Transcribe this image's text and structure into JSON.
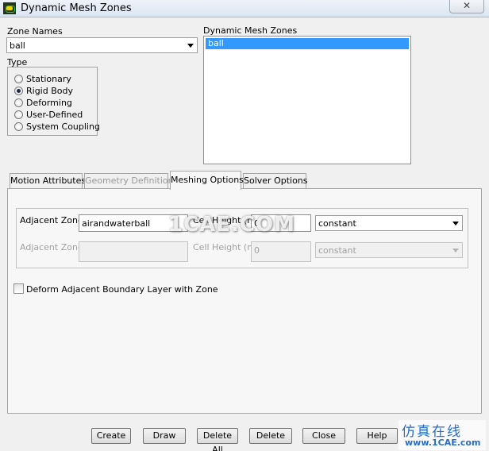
{
  "window": {
    "title": "Dynamic Mesh Zones",
    "close_glyph": "✕"
  },
  "zone_names": {
    "label": "Zone Names",
    "selected": "ball"
  },
  "type": {
    "label": "Type",
    "options": [
      {
        "label": "Stationary",
        "selected": false
      },
      {
        "label": "Rigid Body",
        "selected": true
      },
      {
        "label": "Deforming",
        "selected": false
      },
      {
        "label": "User-Defined",
        "selected": false
      },
      {
        "label": "System Coupling",
        "selected": false
      }
    ]
  },
  "dynamic_mesh_zones": {
    "label": "Dynamic Mesh Zones",
    "items": [
      "ball"
    ]
  },
  "tabs": [
    {
      "label": "Motion Attributes",
      "state": "normal"
    },
    {
      "label": "Geometry Definition",
      "state": "disabled"
    },
    {
      "label": "Meshing Options",
      "state": "active"
    },
    {
      "label": "Solver Options",
      "state": "normal"
    }
  ],
  "meshing": {
    "row1": {
      "zone_label": "Adjacent Zone",
      "zone_value": "airandwaterball",
      "height_label": "Cell Height (m)",
      "height_value": "0",
      "method": "constant"
    },
    "row2": {
      "zone_label": "Adjacent Zone",
      "zone_value": "",
      "height_label": "Cell Height (m)",
      "height_value": "0",
      "method": "constant"
    },
    "deform_checkbox": {
      "label": "Deform Adjacent Boundary Layer with Zone",
      "checked": false
    }
  },
  "buttons": [
    "Create",
    "Draw",
    "Delete All",
    "Delete",
    "Close",
    "Help"
  ],
  "watermark": {
    "main": "1CAE.COM",
    "site_cn": "仿真在线",
    "site_url": "www.1CAE.com"
  },
  "colors": {
    "selection": "#3399ff",
    "watermark_blue": "#2b6cc4"
  }
}
